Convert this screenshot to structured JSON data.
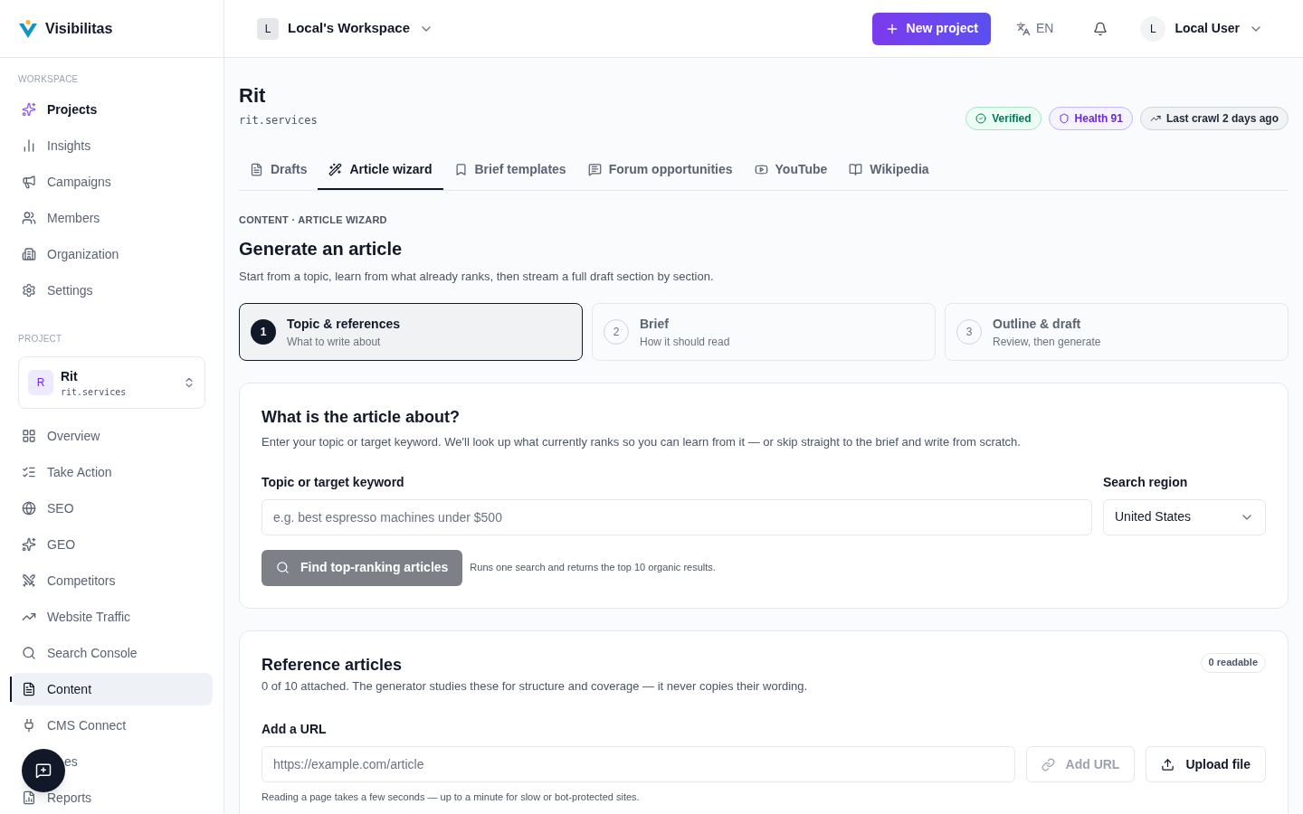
{
  "brand": {
    "name": "Visibilitas"
  },
  "workspace": {
    "initial": "L",
    "name": "Local's Workspace"
  },
  "header": {
    "new_project": "New project",
    "language": "EN",
    "user": {
      "initial": "L",
      "name": "Local User"
    }
  },
  "sidebar": {
    "sections": [
      {
        "title": "WORKSPACE",
        "items": [
          {
            "label": "Projects",
            "selected": false,
            "bold": true
          },
          {
            "label": "Insights",
            "selected": false,
            "bold": false
          },
          {
            "label": "Campaigns",
            "selected": false,
            "bold": false
          },
          {
            "label": "Members",
            "selected": false,
            "bold": false
          },
          {
            "label": "Organization",
            "selected": false,
            "bold": false
          },
          {
            "label": "Settings",
            "selected": false,
            "bold": false
          }
        ]
      },
      {
        "title": "PROJECT"
      }
    ],
    "project": {
      "initial": "R",
      "name": "Rit",
      "domain": "rit.services"
    },
    "project_items": [
      {
        "label": "Overview",
        "selected": false
      },
      {
        "label": "Take Action",
        "selected": false
      },
      {
        "label": "SEO",
        "selected": false
      },
      {
        "label": "GEO",
        "selected": false
      },
      {
        "label": "Competitors",
        "selected": false
      },
      {
        "label": "Website Traffic",
        "selected": false
      },
      {
        "label": "Search Console",
        "selected": false
      },
      {
        "label": "Content",
        "selected": true
      },
      {
        "label": "CMS Connect",
        "selected": false
      },
      {
        "label": "es",
        "selected": false,
        "covered": true
      },
      {
        "label": "Reports",
        "selected": false
      }
    ]
  },
  "page": {
    "title": "Rit",
    "domain": "rit.services",
    "badges": [
      {
        "label": "Verified",
        "kind": "verified"
      },
      {
        "label": "Health 91",
        "kind": "health"
      },
      {
        "label": "Last crawl 2 days ago",
        "kind": "crawl"
      }
    ],
    "tabs": [
      {
        "label": "Drafts",
        "selected": false
      },
      {
        "label": "Article wizard",
        "selected": true
      },
      {
        "label": "Brief templates",
        "selected": false
      },
      {
        "label": "Forum opportunities",
        "selected": false
      },
      {
        "label": "YouTube",
        "selected": false
      },
      {
        "label": "Wikipedia",
        "selected": false
      }
    ]
  },
  "wizard": {
    "breadcrumb": "CONTENT · ARTICLE WIZARD",
    "title": "Generate an article",
    "subtitle": "Start from a topic, learn from what already ranks, then stream a full draft section by section.",
    "steps": [
      {
        "number": "1",
        "title": "Topic & references",
        "subtitle": "What to write about",
        "selected": true
      },
      {
        "number": "2",
        "title": "Brief",
        "subtitle": "How it should read",
        "selected": false
      },
      {
        "number": "3",
        "title": "Outline & draft",
        "subtitle": "Review, then generate",
        "selected": false
      }
    ]
  },
  "topic_card": {
    "title": "What is the article about?",
    "description": "Enter your topic or target keyword. We'll look up what currently ranks so you can learn from it — or skip straight to the brief and write from scratch.",
    "keyword_label": "Topic or target keyword",
    "keyword_placeholder": "e.g. best espresso machines under $500",
    "region_label": "Search region",
    "region_value": "United States",
    "find_button": {
      "label": "Find top-ranking articles",
      "disabled": true
    },
    "find_hint": "Runs one search and returns the top 10 organic results."
  },
  "reference_card": {
    "title": "Reference articles",
    "count_badge": "0 readable",
    "description": "0 of 10 attached. The generator studies these for structure and coverage — it never copies their wording.",
    "url_label": "Add a URL",
    "url_placeholder": "https://example.com/article",
    "add_button": {
      "label": "Add URL",
      "disabled": true
    },
    "upload_button": {
      "label": "Upload file",
      "disabled": false
    },
    "hint": "Reading a page takes a few seconds — up to a minute for slow or bot-protected sites."
  }
}
